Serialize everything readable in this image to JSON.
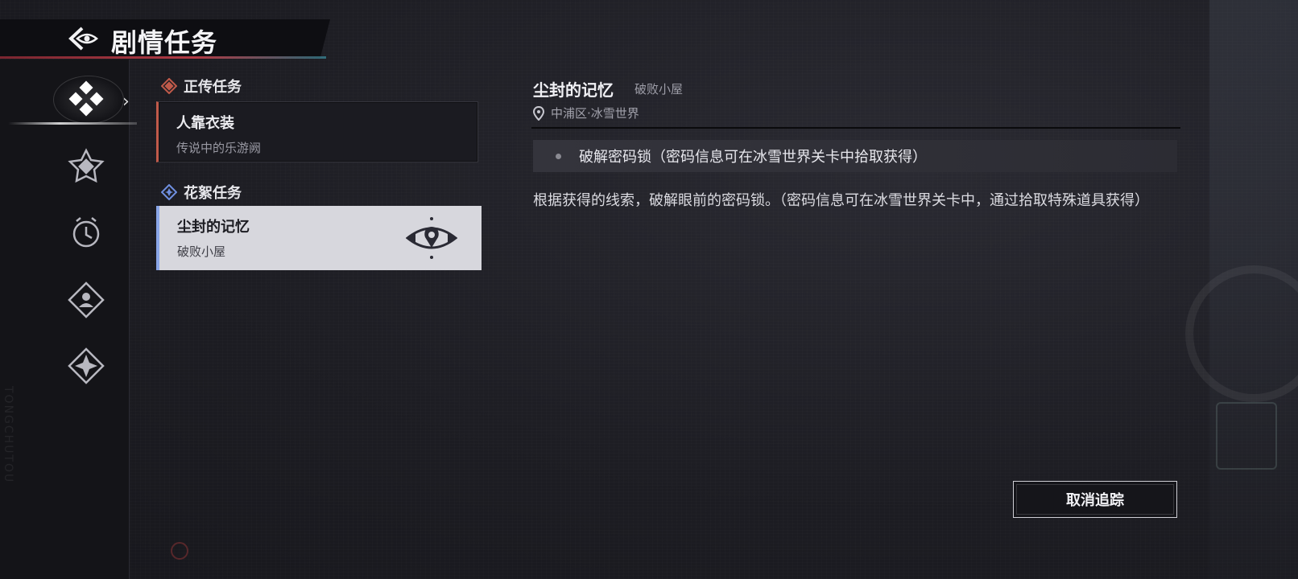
{
  "header": {
    "title": "剧情任务"
  },
  "nav": {
    "items": [
      {
        "icon": "main-quest-diamond-icon",
        "active": true
      },
      {
        "icon": "side-quest-star-icon",
        "active": false
      },
      {
        "icon": "clock-icon",
        "active": false
      },
      {
        "icon": "person-diamond-icon",
        "active": false
      },
      {
        "icon": "compass-star-icon",
        "active": false
      }
    ]
  },
  "quest_list": {
    "main_section": {
      "label": "正传任务",
      "accent": "#c05a4a",
      "quests": [
        {
          "title": "人靠衣装",
          "subtitle": "传说中的乐游阙"
        }
      ]
    },
    "side_section": {
      "label": "花絮任务",
      "accent": "#6f8fe0",
      "quests": [
        {
          "title": "尘封的记忆",
          "subtitle": "破败小屋",
          "selected": true,
          "tracked": true
        }
      ]
    }
  },
  "detail": {
    "title": "尘封的记忆",
    "subtitle": "破败小屋",
    "location": "中浦区·冰雪世界",
    "objective": "破解密码锁（密码信息可在冰雪世界关卡中拾取获得）",
    "description": "根据获得的线索，破解眼前的密码锁。（密码信息可在冰雪世界关卡中，通过拾取特殊道具获得）"
  },
  "actions": {
    "cancel_tracking": "取消追踪"
  }
}
